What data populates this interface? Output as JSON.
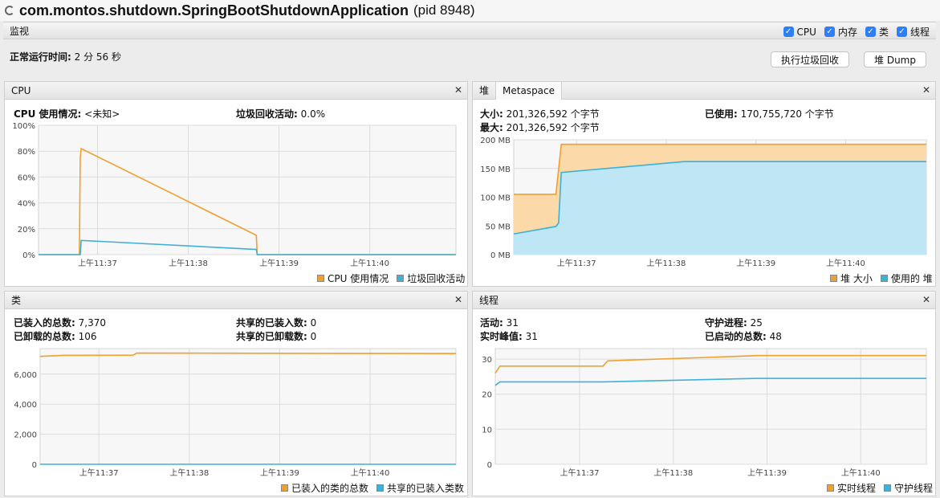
{
  "window": {
    "title": "com.montos.shutdown.SpringBootShutdownApplication",
    "pid": "(pid 8948)"
  },
  "monitor": {
    "label": "监视",
    "checkboxes": [
      {
        "label": "CPU",
        "checked": true
      },
      {
        "label": "内存",
        "checked": true
      },
      {
        "label": "类",
        "checked": true
      },
      {
        "label": "线程",
        "checked": true
      }
    ],
    "uptime_label": "正常运行时间:",
    "uptime_value": "2 分 56 秒",
    "gc_button": "执行垃圾回收",
    "heap_dump_button": "堆 Dump"
  },
  "cpu": {
    "title": "CPU",
    "usage_label": "CPU 使用情况:",
    "usage_value": "<未知>",
    "gc_label": "垃圾回收活动:",
    "gc_value": "0.0%",
    "legend": [
      "CPU 使用情况",
      "垃圾回收活动"
    ]
  },
  "memory": {
    "tab_heap": "堆",
    "tab_metaspace": "Metaspace",
    "size_label": "大小:",
    "size_value": "201,326,592 个字节",
    "used_label": "已使用:",
    "used_value": "170,755,720 个字节",
    "max_label": "最大:",
    "max_value": "201,326,592 个字节",
    "legend": [
      "堆 大小",
      "使用的 堆"
    ]
  },
  "classes": {
    "title": "类",
    "loaded_label": "已装入的总数:",
    "loaded_value": "7,370",
    "unloaded_label": "已卸载的总数:",
    "unloaded_value": "106",
    "shared_loaded_label": "共享的已装入数:",
    "shared_loaded_value": "0",
    "shared_unloaded_label": "共享的已卸载数:",
    "shared_unloaded_value": "0",
    "legend": [
      "已装入的类的总数",
      "共享的已装入类数"
    ]
  },
  "threads": {
    "title": "线程",
    "live_label": "活动:",
    "live_value": "31",
    "peak_label": "实时峰值:",
    "peak_value": "31",
    "daemon_label": "守护进程:",
    "daemon_value": "25",
    "started_label": "已启动的总数:",
    "started_value": "48",
    "legend": [
      "实时线程",
      "守护线程"
    ]
  },
  "colors": {
    "orange": "#f0a030",
    "blue": "#3fb0d8",
    "orange_fill": "#fbd9a8",
    "blue_fill": "#bfe6f5"
  },
  "chart_data": [
    {
      "type": "line",
      "id": "cpu",
      "x_ticks": [
        "上午11:37",
        "上午11:38",
        "上午11:39",
        "上午11:40"
      ],
      "y_ticks": [
        "0%",
        "20%",
        "40%",
        "60%",
        "80%",
        "100%"
      ],
      "ylim": [
        0,
        100
      ],
      "series": [
        {
          "name": "CPU 使用情况",
          "points": [
            [
              0,
              0
            ],
            [
              0.45,
              0
            ],
            [
              0.46,
              75
            ],
            [
              0.47,
              82
            ],
            [
              2.4,
              15
            ],
            [
              2.41,
              0
            ],
            [
              4.6,
              0
            ]
          ]
        },
        {
          "name": "垃圾回收活动",
          "points": [
            [
              0,
              0
            ],
            [
              0.46,
              0
            ],
            [
              0.47,
              11
            ],
            [
              2.4,
              4
            ],
            [
              2.41,
              0
            ],
            [
              4.6,
              0
            ]
          ]
        }
      ]
    },
    {
      "type": "area",
      "id": "heap",
      "x_ticks": [
        "上午11:37",
        "上午11:38",
        "上午11:39",
        "上午11:40"
      ],
      "y_ticks": [
        "0 MB",
        "50 MB",
        "100 MB",
        "150 MB",
        "200 MB"
      ],
      "ylim": [
        0,
        200
      ],
      "series": [
        {
          "name": "堆 大小",
          "points": [
            [
              0,
              105
            ],
            [
              0.47,
              105
            ],
            [
              0.53,
              192
            ],
            [
              4.6,
              192
            ]
          ]
        },
        {
          "name": "使用的 堆",
          "points": [
            [
              0,
              36
            ],
            [
              0.47,
              49
            ],
            [
              0.5,
              55
            ],
            [
              0.53,
              143
            ],
            [
              1.9,
              162
            ],
            [
              4.6,
              162
            ]
          ]
        }
      ]
    },
    {
      "type": "line",
      "id": "classes",
      "x_ticks": [
        "上午11:37",
        "上午11:38",
        "上午11:39",
        "上午11:40"
      ],
      "y_ticks": [
        "0",
        "2,000",
        "4,000",
        "6,000"
      ],
      "ylim": [
        0,
        7700
      ],
      "series": [
        {
          "name": "已装入的类的总数",
          "points": [
            [
              0,
              7180
            ],
            [
              0.25,
              7250
            ],
            [
              1.03,
              7260
            ],
            [
              1.07,
              7400
            ],
            [
              4.6,
              7370
            ]
          ]
        },
        {
          "name": "共享的已装入类数",
          "points": [
            [
              0,
              0
            ],
            [
              4.6,
              0
            ]
          ]
        }
      ]
    },
    {
      "type": "line",
      "id": "threads",
      "x_ticks": [
        "上午11:37",
        "上午11:38",
        "上午11:39",
        "上午11:40"
      ],
      "y_ticks": [
        "0",
        "10",
        "20",
        "30"
      ],
      "ylim": [
        0,
        33
      ],
      "series": [
        {
          "name": "实时线程",
          "points": [
            [
              0,
              26
            ],
            [
              0.05,
              28
            ],
            [
              1.15,
              28
            ],
            [
              1.2,
              29.5
            ],
            [
              2.8,
              31
            ],
            [
              4.6,
              31
            ]
          ]
        },
        {
          "name": "守护线程",
          "points": [
            [
              0,
              22.5
            ],
            [
              0.05,
              23.5
            ],
            [
              1.15,
              23.5
            ],
            [
              2.8,
              24.5
            ],
            [
              4.6,
              24.5
            ]
          ]
        }
      ]
    }
  ]
}
